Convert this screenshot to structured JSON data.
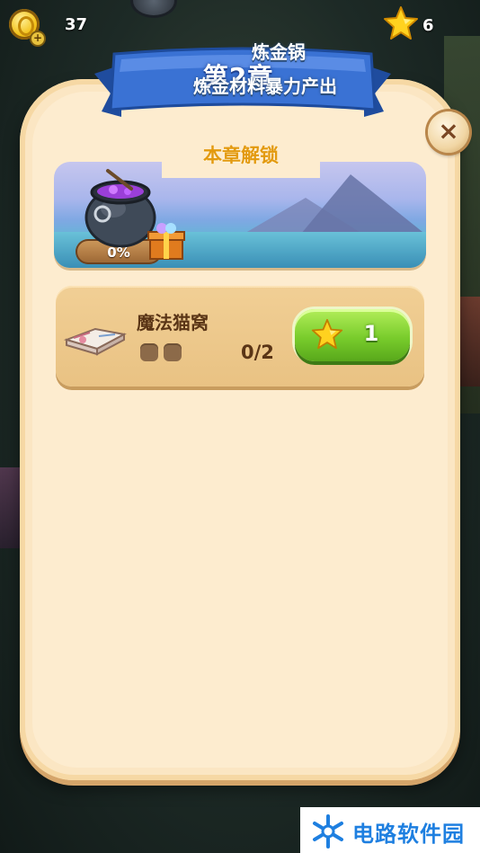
{
  "hud": {
    "coins": "37",
    "stars": "6",
    "coin_icon": "gold-coin-icon",
    "star_icon": "star-icon"
  },
  "dialog": {
    "title": "第2章",
    "close_icon": "close-icon",
    "section_label": "本章解锁",
    "feature": {
      "title": "炼金锅",
      "description": "炼金材料暴力产出",
      "progress": "0%",
      "progress_value": 0,
      "icon": "cauldron-icon",
      "gift_icon": "gift-box-icon"
    },
    "item": {
      "name": "魔法猫窝",
      "progress": "0/2",
      "filled": 0,
      "total": 2,
      "icon": "book-icon",
      "button_cost": "1",
      "button_icon": "star-icon"
    }
  },
  "watermark": {
    "text": "电路软件园"
  },
  "colors": {
    "ribbon_blue": "#2f66c9",
    "panel_cream": "#fdeccf",
    "section_orange": "#e39a10",
    "button_green": "#79cc2c",
    "text_brown": "#5a3516"
  }
}
